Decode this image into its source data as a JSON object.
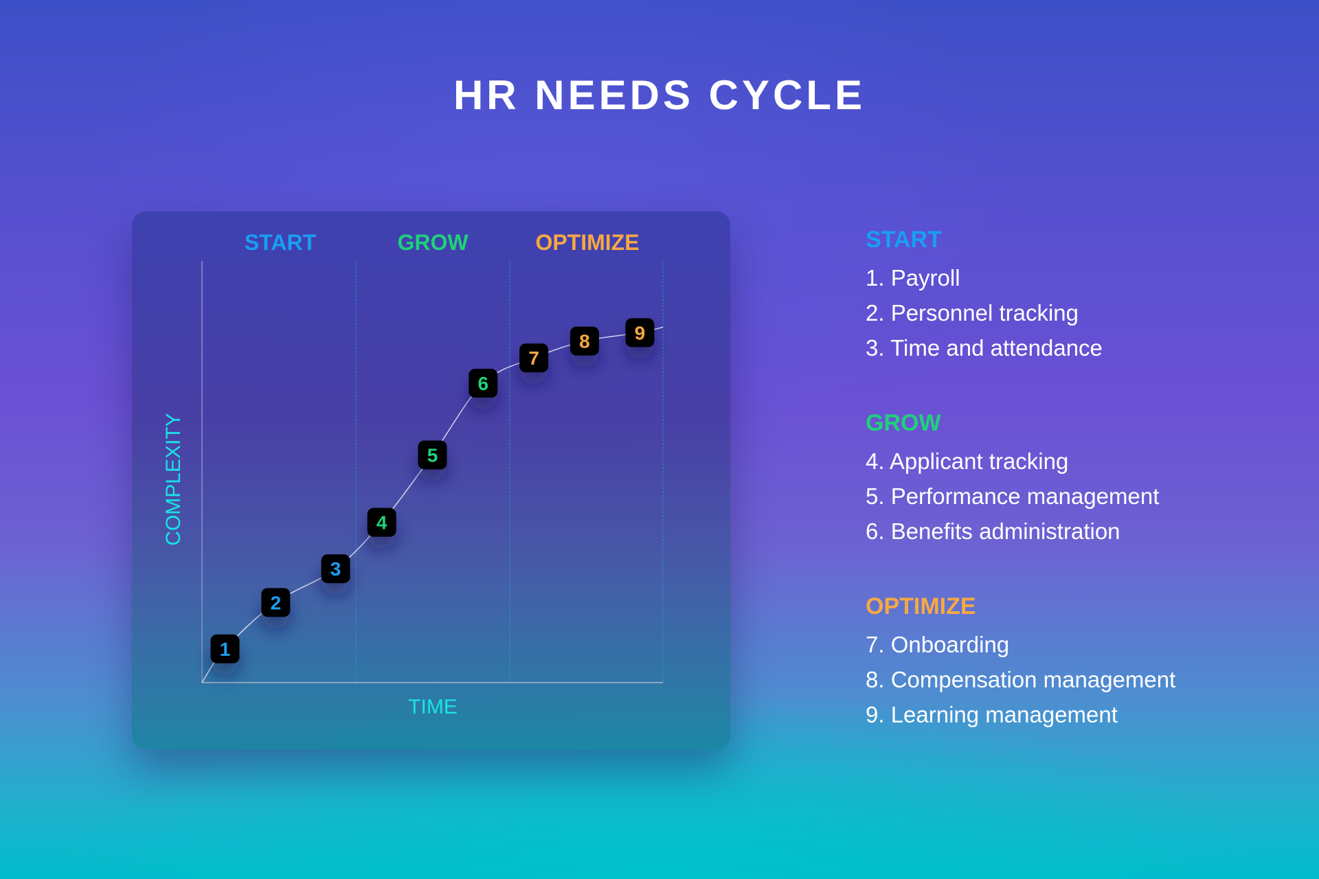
{
  "title": "HR NEEDS CYCLE",
  "colors": {
    "start": "#1a9ef2",
    "grow": "#1fd17a",
    "optimize": "#f7a844",
    "axis_label": "#19e4e6",
    "marker_bg": "#000000"
  },
  "chart": {
    "column_headers": [
      "START",
      "GROW",
      "OPTIMIZE"
    ],
    "y_axis_label": "COMPLEXITY",
    "x_axis_label": "TIME"
  },
  "chart_data": {
    "type": "line",
    "title": "HR NEEDS CYCLE",
    "xlabel": "TIME",
    "ylabel": "COMPLEXITY",
    "phases": [
      "START",
      "GROW",
      "OPTIMIZE"
    ],
    "points": [
      {
        "label": "1",
        "phase": "START",
        "x": 0.05,
        "y": 0.08
      },
      {
        "label": "2",
        "phase": "START",
        "x": 0.16,
        "y": 0.19
      },
      {
        "label": "3",
        "phase": "START",
        "x": 0.29,
        "y": 0.27
      },
      {
        "label": "4",
        "phase": "GROW",
        "x": 0.39,
        "y": 0.38
      },
      {
        "label": "5",
        "phase": "GROW",
        "x": 0.5,
        "y": 0.54
      },
      {
        "label": "6",
        "phase": "GROW",
        "x": 0.61,
        "y": 0.71
      },
      {
        "label": "7",
        "phase": "OPTIMIZE",
        "x": 0.72,
        "y": 0.77
      },
      {
        "label": "8",
        "phase": "OPTIMIZE",
        "x": 0.83,
        "y": 0.81
      },
      {
        "label": "9",
        "phase": "OPTIMIZE",
        "x": 0.95,
        "y": 0.83
      }
    ],
    "xlim": [
      0,
      1
    ],
    "ylim": [
      0,
      1
    ],
    "grid": false
  },
  "legend": [
    {
      "heading": "START",
      "items": [
        "1. Payroll",
        "2. Personnel tracking",
        "3. Time and attendance"
      ]
    },
    {
      "heading": "GROW",
      "items": [
        "4. Applicant tracking",
        "5. Performance management",
        "6. Benefits administration"
      ]
    },
    {
      "heading": "OPTIMIZE",
      "items": [
        "7. Onboarding",
        "8. Compensation management",
        "9. Learning management"
      ]
    }
  ]
}
